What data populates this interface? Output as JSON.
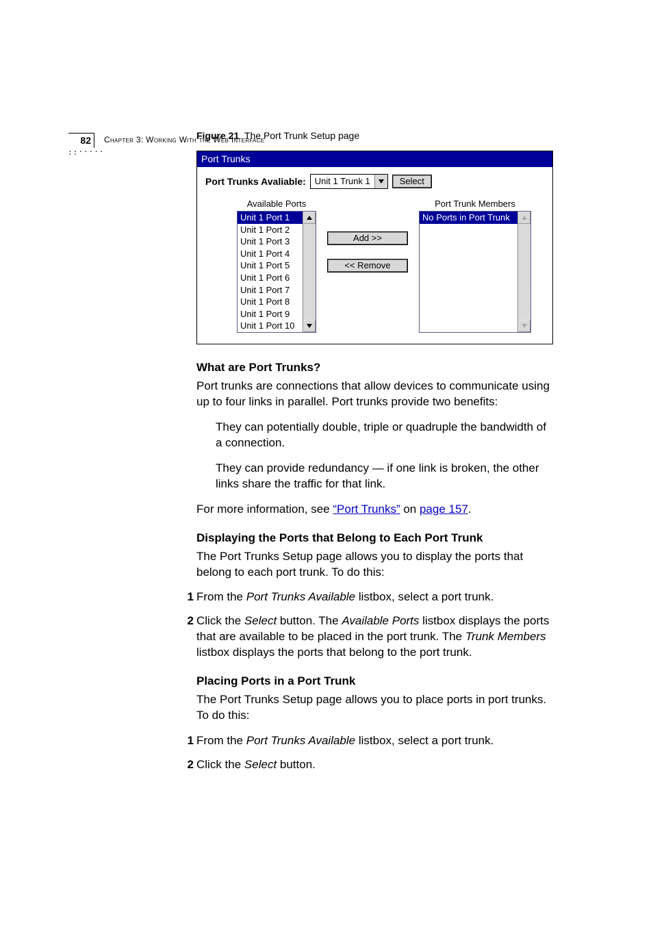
{
  "header": {
    "page_number": "82",
    "chapter_label": "Chapter 3: Working With the Web Interface"
  },
  "figure": {
    "label": "Figure 21",
    "caption": "The Port Trunk Setup page"
  },
  "shot": {
    "title": "Port Trunks",
    "available_label": "Port Trunks Avaliable:",
    "dropdown_value": "Unit 1 Trunk 1",
    "select_btn": "Select",
    "avail_title": "Available Ports",
    "members_title": "Port Trunk Members",
    "members_empty": "No Ports in Port Trunk",
    "add_btn": "Add >>",
    "remove_btn": "<< Remove",
    "ports": [
      "Unit 1 Port 1",
      "Unit 1 Port 2",
      "Unit 1 Port 3",
      "Unit 1 Port 4",
      "Unit 1 Port 5",
      "Unit 1 Port 6",
      "Unit 1 Port 7",
      "Unit 1 Port 8",
      "Unit 1 Port 9",
      "Unit 1 Port 10"
    ]
  },
  "sections": {
    "s1_title": "What are Port Trunks?",
    "s1_p1": "Port trunks are connections that allow devices to communicate using up to four links in parallel. Port trunks provide two benefits:",
    "s1_b1": "They can potentially double, triple or quadruple the bandwidth of a connection.",
    "s1_b2": "They can provide redundancy — if one link is broken, the other links share the traffic for that link.",
    "s1_more_pre": "For more information, see ",
    "s1_link1": "“Port Trunks”",
    "s1_more_mid": " on ",
    "s1_link2": "page 157",
    "s1_more_post": ".",
    "s2_title": "Displaying the Ports that Belong to Each Port Trunk",
    "s2_p1": "The Port Trunks Setup page allows you to display the ports that belong to each port trunk. To do this:",
    "s2_n1_a": "From the ",
    "s2_n1_i": "Port Trunks Available",
    "s2_n1_b": " listbox, select a port trunk.",
    "s2_n2_a": "Click the ",
    "s2_n2_i1": "Select",
    "s2_n2_b": " button. The ",
    "s2_n2_i2": "Available Ports",
    "s2_n2_c": " listbox displays the ports that are available to be placed in the port trunk. The ",
    "s2_n2_i3": "Trunk Members",
    "s2_n2_d": " listbox displays the ports that belong to the port trunk.",
    "s3_title": "Placing Ports in a Port Trunk",
    "s3_p1": "The Port Trunks Setup page allows you to place ports in port trunks. To do this:",
    "s3_n1_a": "From the ",
    "s3_n1_i": "Port Trunks Available",
    "s3_n1_b": " listbox, select a port trunk.",
    "s3_n2_a": "Click the ",
    "s3_n2_i": "Select",
    "s3_n2_b": " button."
  },
  "nums": {
    "one": "1",
    "two": "2"
  }
}
